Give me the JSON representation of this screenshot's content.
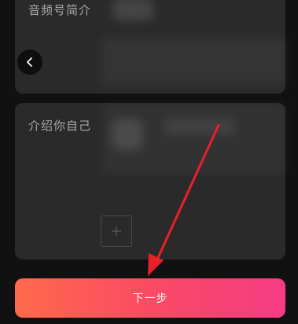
{
  "profile_form": {
    "intro_label": "音频号简介",
    "about_label": "介绍你自己",
    "next_label": "下一步"
  },
  "icons": {
    "back": "chevron-left-icon",
    "add": "plus-icon",
    "annotation": "red-arrow-annotation"
  },
  "colors": {
    "page_bg": "#111111",
    "card_bg": "#2a2a2a",
    "label": "#a8a8a8",
    "button_gradient_start": "#fe6a4b",
    "button_gradient_end": "#f63b84",
    "annotation_arrow": "#e8202a"
  }
}
